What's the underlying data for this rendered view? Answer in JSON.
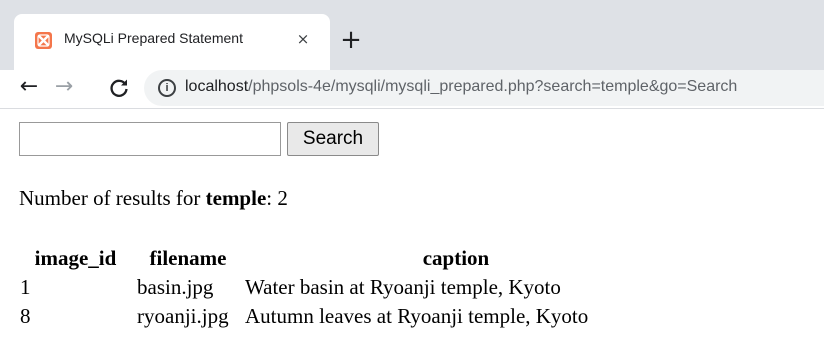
{
  "browser": {
    "tab": {
      "title": "MySQLi Prepared Statement",
      "favicon": "xampp-icon",
      "close_glyph": "×"
    },
    "new_tab_glyph": "+",
    "nav": {
      "back_glyph": "←",
      "forward_glyph": "→",
      "reload": "reload-icon"
    },
    "address": {
      "info_glyph": "i",
      "host": "localhost",
      "path": "/phpsols-4e/mysqli/mysqli_prepared.php?search=temple&go=Search"
    }
  },
  "page": {
    "search": {
      "value": "",
      "button_label": "Search"
    },
    "results": {
      "prefix": "Number of results for ",
      "term": "temple",
      "separator": ": ",
      "count": "2"
    },
    "table": {
      "headers": [
        "image_id",
        "filename",
        "caption"
      ],
      "rows": [
        [
          "1",
          "basin.jpg",
          "Water basin at Ryoanji temple, Kyoto"
        ],
        [
          "8",
          "ryoanji.jpg",
          "Autumn leaves at Ryoanji temple, Kyoto"
        ]
      ]
    }
  },
  "colors": {
    "tabstrip": "#dee1e6",
    "omnibox": "#f1f3f4",
    "favicon": "#f4764b"
  }
}
